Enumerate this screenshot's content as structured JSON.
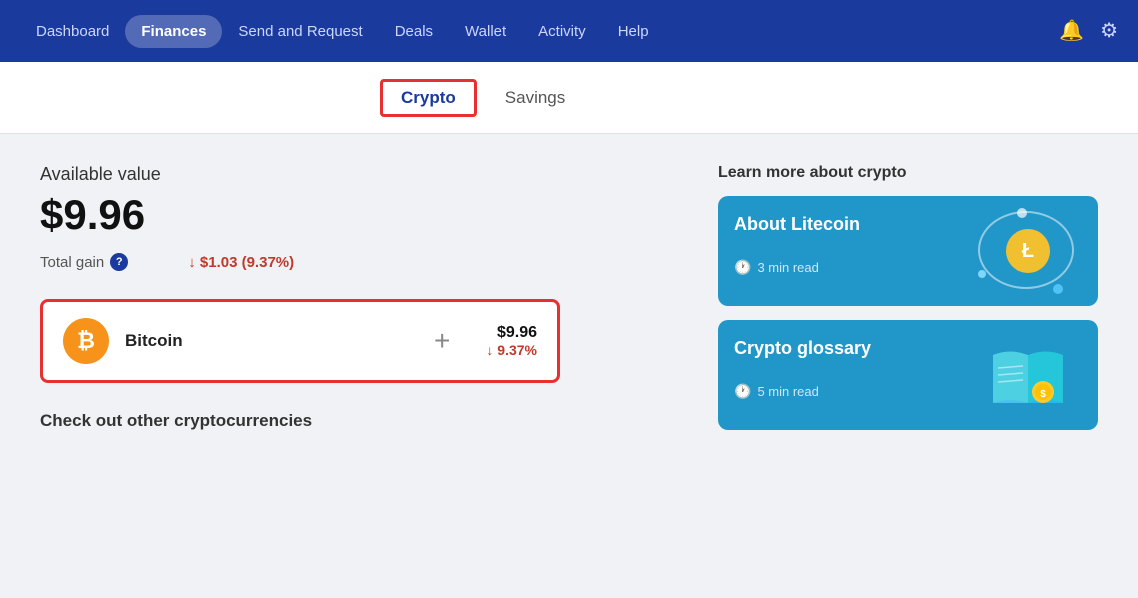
{
  "navbar": {
    "items": [
      {
        "label": "Dashboard",
        "active": false
      },
      {
        "label": "Finances",
        "active": true
      },
      {
        "label": "Send and Request",
        "active": false
      },
      {
        "label": "Deals",
        "active": false
      },
      {
        "label": "Wallet",
        "active": false
      },
      {
        "label": "Activity",
        "active": false
      },
      {
        "label": "Help",
        "active": false
      }
    ]
  },
  "sub_tabs": [
    {
      "label": "Crypto",
      "active": true
    },
    {
      "label": "Savings",
      "active": false
    }
  ],
  "main": {
    "available_label": "Available value",
    "available_value": "$9.96",
    "total_gain_label": "Total gain",
    "total_gain_value": "↓ $1.03 (9.37%)",
    "crypto_card": {
      "name": "Bitcoin",
      "price": "$9.96",
      "change": "↓ 9.37%",
      "plus_label": "+"
    },
    "other_cryptos_label": "Check out other cryptocurrencies"
  },
  "right_panel": {
    "learn_label": "Learn more about crypto",
    "articles": [
      {
        "title": "About Litecoin",
        "read_time": "3 min read"
      },
      {
        "title": "Crypto glossary",
        "read_time": "5 min read"
      }
    ]
  }
}
